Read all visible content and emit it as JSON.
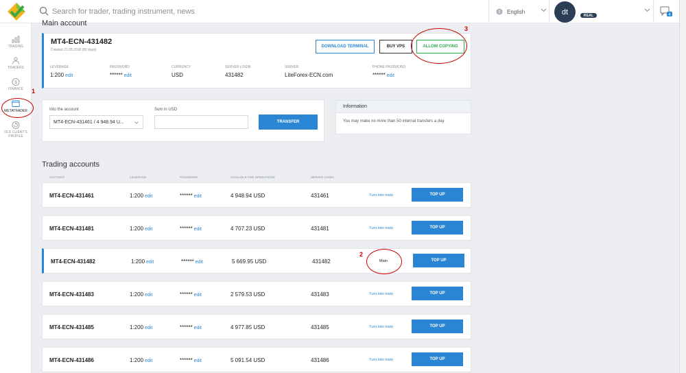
{
  "header": {
    "search_placeholder": "Search for trader, trading instrument, news",
    "language": "English",
    "avatar_initials": "dt",
    "account_badge": "REAL"
  },
  "sidebar": {
    "items": [
      {
        "label": "TRADING",
        "icon": "bar-chart-icon"
      },
      {
        "label": "TRADERS",
        "icon": "traders-icon"
      },
      {
        "label": "FINANCE",
        "icon": "dollar-icon"
      },
      {
        "label": "METATRADER",
        "icon": "metatrader-window-icon",
        "active": true
      },
      {
        "label": "OLD CLIENT'S PROFILE",
        "icon": "old-profile-icon"
      }
    ]
  },
  "annotations": [
    "1",
    "2",
    "3"
  ],
  "main_account": {
    "section_title": "Main account",
    "title": "MT4-ECN-431482",
    "created": "Created 21.05.2018 (80 days)",
    "buttons": {
      "download_terminal": "DOWNLOAD TERMINAL",
      "buy_vps": "BUY VPS",
      "allow_copying": "ALLOW COPYING"
    },
    "fields": {
      "leverage": {
        "label": "LEVERAGE",
        "value": "1:200",
        "edit": "edit"
      },
      "password": {
        "label": "PASSWORD",
        "value": "******",
        "edit": "edit"
      },
      "currency": {
        "label": "CURRENCY",
        "value": "USD"
      },
      "server_login": {
        "label": "SERVER LOGIN",
        "value": "431482"
      },
      "server": {
        "label": "SERVER",
        "value": "LiteForex-ECN.com"
      },
      "phone_password": {
        "label": "PHONE PASSWORD",
        "value": "******",
        "edit": "edit"
      }
    }
  },
  "transfer": {
    "into_label": "Into the account",
    "into_value": "MT4-ECN-431461 / 4 948.94 U...",
    "sum_label": "Sum in USD",
    "sum_value": "",
    "button": "TRANSFER"
  },
  "information": {
    "title": "Information",
    "text": "You may make no more than 50 internal transfers a day."
  },
  "trading_accounts": {
    "section_title": "Trading accounts",
    "columns": [
      "ACCOUNT",
      "LEVERAGE",
      "PASSWORD",
      "AVAILABLE FOR OPERATIONS",
      "SERVER LOGIN"
    ],
    "edit_label": "edit",
    "turn_into_main_label": "Turn into main",
    "main_label": "Main",
    "top_up_label": "TOP UP",
    "rows": [
      {
        "account": "MT4-ECN-431461",
        "leverage": "1:200",
        "password": "******",
        "available": "4 948.94 USD",
        "server_login": "431461",
        "is_main": false
      },
      {
        "account": "MT4-ECN-431481",
        "leverage": "1:200",
        "password": "******",
        "available": "4 707.23 USD",
        "server_login": "431481",
        "is_main": false
      },
      {
        "account": "MT4-ECN-431482",
        "leverage": "1:200",
        "password": "******",
        "available": "5 669.95 USD",
        "server_login": "431482",
        "is_main": true
      },
      {
        "account": "MT4-ECN-431483",
        "leverage": "1:200",
        "password": "******",
        "available": "2 579.53 USD",
        "server_login": "431483",
        "is_main": false
      },
      {
        "account": "MT4-ECN-431485",
        "leverage": "1:200",
        "password": "******",
        "available": "4 977.85 USD",
        "server_login": "431485",
        "is_main": false
      },
      {
        "account": "MT4-ECN-431486",
        "leverage": "1:200",
        "password": "******",
        "available": "5 091.54 USD",
        "server_login": "431486",
        "is_main": false
      }
    ]
  },
  "colors": {
    "accent": "#2a86d4",
    "allow_copying": "#2eaa4b",
    "annotation": "#cc0000",
    "avatar_bg": "#2c3e55"
  }
}
